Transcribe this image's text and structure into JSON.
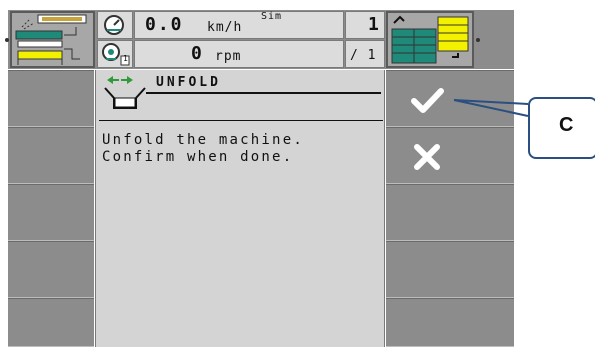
{
  "header": {
    "speed_value": "0.0",
    "speed_unit": "km/h",
    "sim_label": "Sim",
    "rpm_value": "0",
    "rpm_unit": "rpm",
    "counter_value": "1",
    "counter_sub": "/ 1",
    "gauge_icon": "speedometer-icon",
    "pto_icon": "pto-icon",
    "pto_badge": "1"
  },
  "dialog": {
    "title": "UNFOLD",
    "message_lines": [
      "Unfold the machine.",
      "Confirm when done."
    ],
    "title_icon": "unfold-machine-icon"
  },
  "softkeys": {
    "confirm_icon": "checkmark-icon",
    "cancel_icon": "close-icon"
  },
  "callout": {
    "label": "C"
  },
  "colors": {
    "softkey_gray": "#8c8c8c",
    "panel_gray": "#d4d4d4",
    "field_green": "#1f8a7a",
    "field_yellow": "#f3f000",
    "callout_border": "#2b4f80"
  }
}
